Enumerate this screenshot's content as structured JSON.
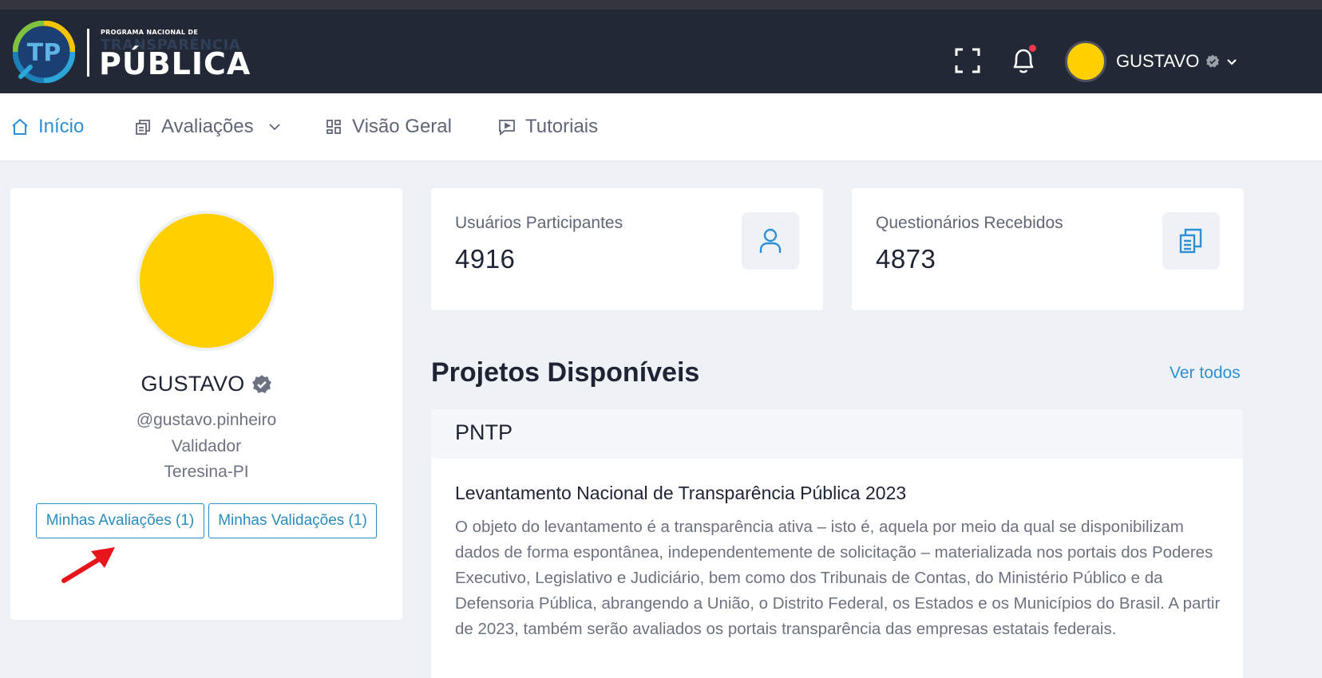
{
  "header": {
    "logo_small": "PROGRAMA NACIONAL DE",
    "logo_mid": "TRANSPARÊNCIA",
    "logo_big": "PÚBLICA",
    "logo_monogram": "TP",
    "user_name": "GUSTAVO",
    "notification_dot_color": "#e83a4b",
    "avatar_color": "#ffcf00"
  },
  "nav": {
    "items": [
      {
        "label": "Início",
        "icon": "home-icon",
        "active": true
      },
      {
        "label": "Avaliações",
        "icon": "documents-icon",
        "has_dropdown": true
      },
      {
        "label": "Visão Geral",
        "icon": "grid-icon"
      },
      {
        "label": "Tutoriais",
        "icon": "chat-video-icon"
      }
    ],
    "accent_color": "#2d8fd5"
  },
  "profile": {
    "name": "GUSTAVO",
    "username": "@gustavo.pinheiro",
    "role": "Validador",
    "location": "Teresina-PI",
    "buttons": {
      "evaluations": "Minhas Avaliações (1)",
      "validations": "Minhas Validações (1)"
    }
  },
  "stats": [
    {
      "label": "Usuários Participantes",
      "value": "4916",
      "icon": "user-icon"
    },
    {
      "label": "Questionários Recebidos",
      "value": "4873",
      "icon": "documents-icon"
    }
  ],
  "projects": {
    "title": "Projetos Disponíveis",
    "see_all": "Ver todos",
    "items": [
      {
        "tag": "PNTP",
        "title": "Levantamento Nacional de Transparência Pública 2023",
        "description": "O objeto do levantamento é a transparência ativa – isto é, aquela por meio da qual se disponibilizam dados de forma espontânea, independentemente de solicitação – materializada nos portais dos Poderes Executivo, Legislativo e Judiciário, bem como dos Tribunais de Contas, do Ministério Público e da Defensoria Pública, abrangendo a União, o Distrito Federal, os Estados e os Municípios do Brasil. A partir de 2023, também serão avaliados os portais transparência das empresas estatais federais."
      }
    ]
  },
  "annotation": {
    "type": "red-arrow",
    "color": "#e8141c"
  }
}
